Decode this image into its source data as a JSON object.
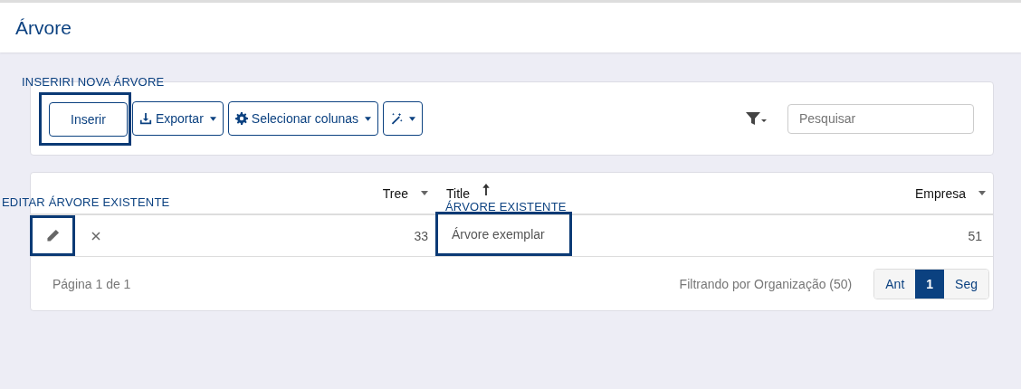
{
  "page": {
    "title": "Árvore"
  },
  "toolbar": {
    "buttons": [
      {
        "kind": "plain",
        "label": "Inserir",
        "annotation": "INSERIRI NOVA ÁRVORE"
      },
      {
        "kind": "download",
        "label": "Exportar"
      },
      {
        "kind": "gear",
        "label": "Selecionar colunas"
      },
      {
        "kind": "wand"
      }
    ],
    "search": {
      "placeholder": "Pesquisar"
    }
  },
  "table": {
    "columns": [
      {
        "label": "Tree",
        "sorted": false
      },
      {
        "label": "Title",
        "sorted": true
      },
      {
        "label": "Empresa",
        "sorted": false
      }
    ],
    "edit_annotation": "EDITAR ÁRVORE EXISTENTE",
    "title_annotation": "ÁRVORE EXISTENTE",
    "rows": [
      {
        "tree": "33",
        "title": "Árvore exemplar",
        "empresa": "51"
      }
    ]
  },
  "footer": {
    "page_info": "Página 1 de 1",
    "filter_info": "Filtrando por Organização (50)",
    "pages": [
      {
        "label": "Ant",
        "selected": false
      },
      {
        "label": "1",
        "selected": true
      },
      {
        "label": "Seg",
        "selected": false
      }
    ]
  }
}
